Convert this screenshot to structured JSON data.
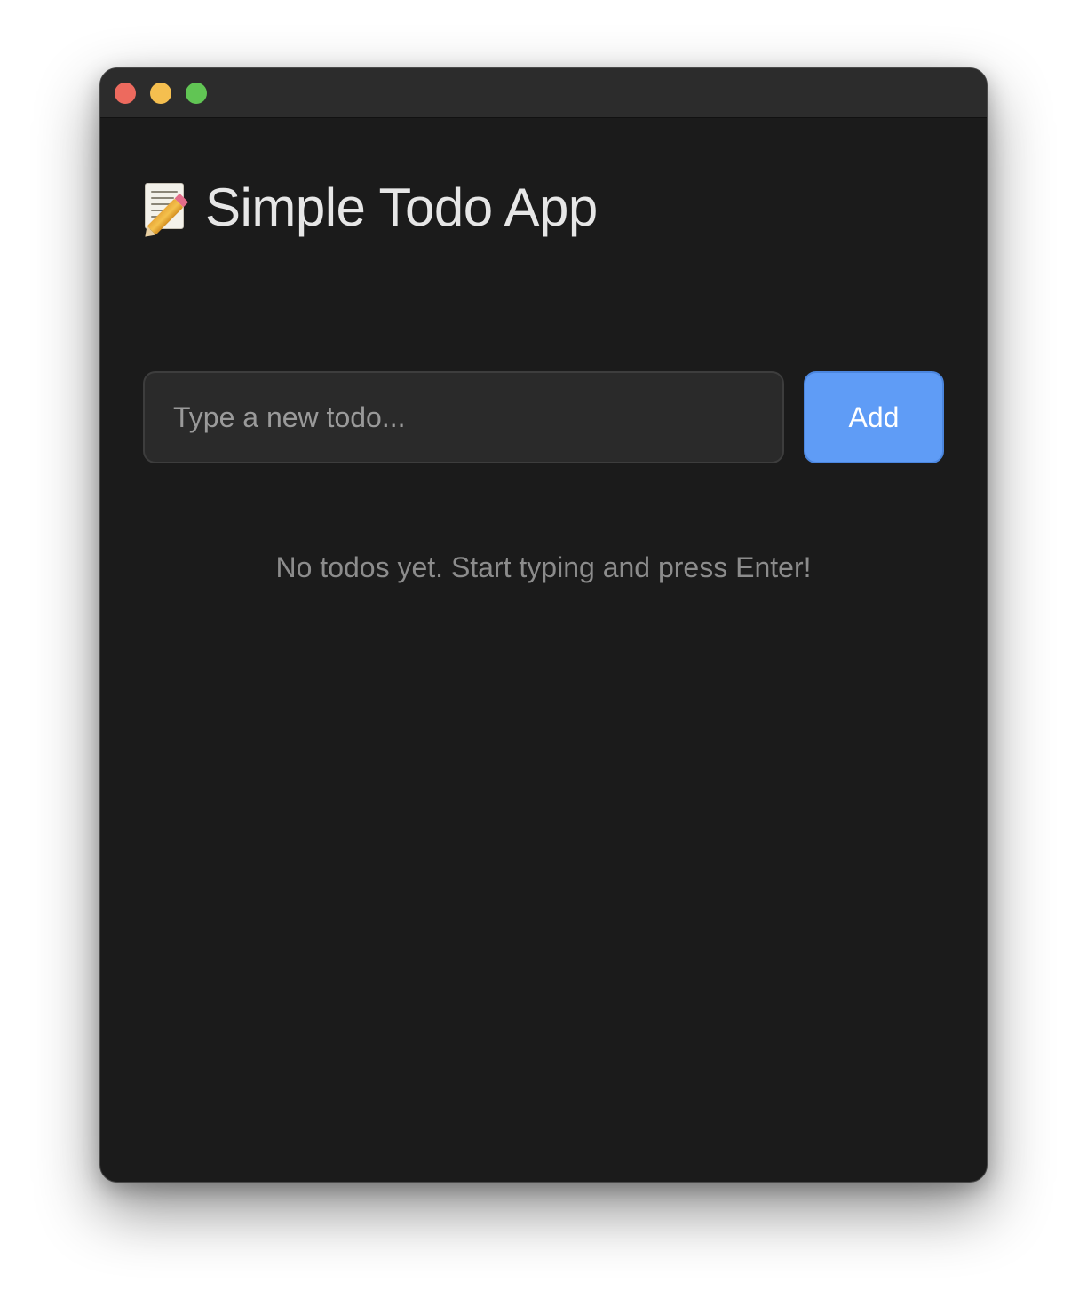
{
  "window": {
    "controls": [
      {
        "name": "close",
        "color": "#ed6a5e"
      },
      {
        "name": "minimize",
        "color": "#f5bf4f"
      },
      {
        "name": "zoom",
        "color": "#61c554"
      }
    ]
  },
  "header": {
    "icon": "memo-icon",
    "title": "Simple Todo App"
  },
  "form": {
    "input_value": "",
    "input_placeholder": "Type a new todo...",
    "add_label": "Add"
  },
  "todos": [],
  "empty_message": "No todos yet. Start typing and press Enter!",
  "colors": {
    "background": "#1b1b1b",
    "accent": "#5f9cf6",
    "text": "#e6e6e6",
    "muted": "#8c8c8c"
  }
}
